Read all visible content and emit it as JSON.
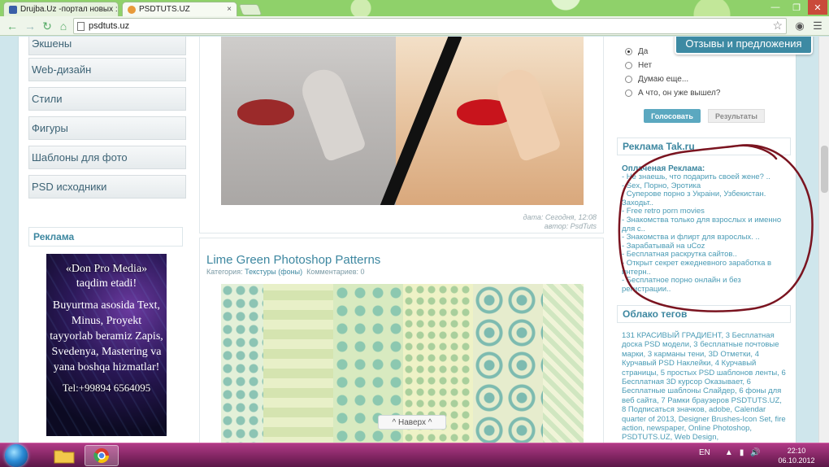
{
  "browser": {
    "tabs": [
      {
        "title": "Drujba.Uz -портал новых :",
        "close": "×",
        "active": false
      },
      {
        "title": "PSDTUTS.UZ",
        "close": "×",
        "active": true
      }
    ],
    "url": "psdtuts.uz",
    "window_controls": {
      "minimize": "—",
      "maximize": "❐",
      "close": "✕"
    }
  },
  "sidebar": {
    "categories": [
      "Экшены",
      "Web-дизайн",
      "Стили",
      "Фигуры",
      "Шаблоны для фото",
      "PSD исходники"
    ],
    "ad_title": "Реклама",
    "banner": {
      "line1": "«Don Pro Media»",
      "line2": "taqdim etadi!",
      "body": "Buyurtma asosida Text, Minus, Proyekt tayyorlab beramiz Zapis, Svedenya, Mastering va yana boshqa hizmatlar!",
      "tel": "Tel:+99894 6564095"
    }
  },
  "posts": {
    "first_meta": {
      "date": "дата: Сегодня, 12:08",
      "author": "автор: PsdTuts"
    },
    "second": {
      "title": "Lime Green Photoshop Patterns",
      "category_label": "Категория:",
      "category": "Текстуры (фоны)",
      "comments": "Комментариев: 0"
    },
    "back_to_top": "^ Наверх ^"
  },
  "right": {
    "feedback": "Отзывы и предложения",
    "poll": {
      "options": [
        "Да",
        "Нет",
        "Думаю еще...",
        "А что, он уже вышел?"
      ],
      "selected": 0,
      "vote": "Голосовать",
      "results": "Результаты"
    },
    "ads_title": "Реклама Tak.ru",
    "paid_title": "Оплаченая Реклама:",
    "paid_items": [
      "- Не знаешь, что подарить своей жене? ..",
      "- Sex, Порно, Эротика",
      "- Суперове порно з Украіни, Узбекистан. Заходьт..",
      "- Free retro porn movies",
      "- Знакомства только для взрослых и именно для с..",
      "- Знакомства и флирт для взрослых. ..",
      "- Зарабатывай на uCoz",
      "- Бесплатная раскрутка сайтов..",
      "- Открыт секрет ежедневного заработка в интерн..",
      "- Бесплатное порно онлайн и без регистрации.."
    ],
    "tags_title": "Облако тегов",
    "tags_text": "131 КРАСИВЫЙ ГРАДИЕНТ, 3 Бесплатная доска PSD модели, 3 бесплатные почтовые марки, 3 карманы тени, 3D Отметки, 4 Курчавый PSD Наклейки, 4 Курчавый страницы, 5 простых PSD шаблонов ленты, 6 Бесплатная 3D курсор Оказывает, 6 Бесплатные шаблоны Слайдер, 6 фоны для веб сайта, 7 Рамки браузеров PSDTUTS.UZ, 8 Подписаться значков, adobe, Calendar quarter of 2013, Designer Brushes-Icon Set, fire action, newspaper, Online Photoshop, PSDTUTS.UZ, Web Design,"
  },
  "taskbar": {
    "lang": "EN",
    "time": "22:10",
    "date": "06.10.2012"
  },
  "colors": {
    "accent": "#3d87a0",
    "link": "#4a9bb5",
    "scribble": "#7a1420"
  }
}
